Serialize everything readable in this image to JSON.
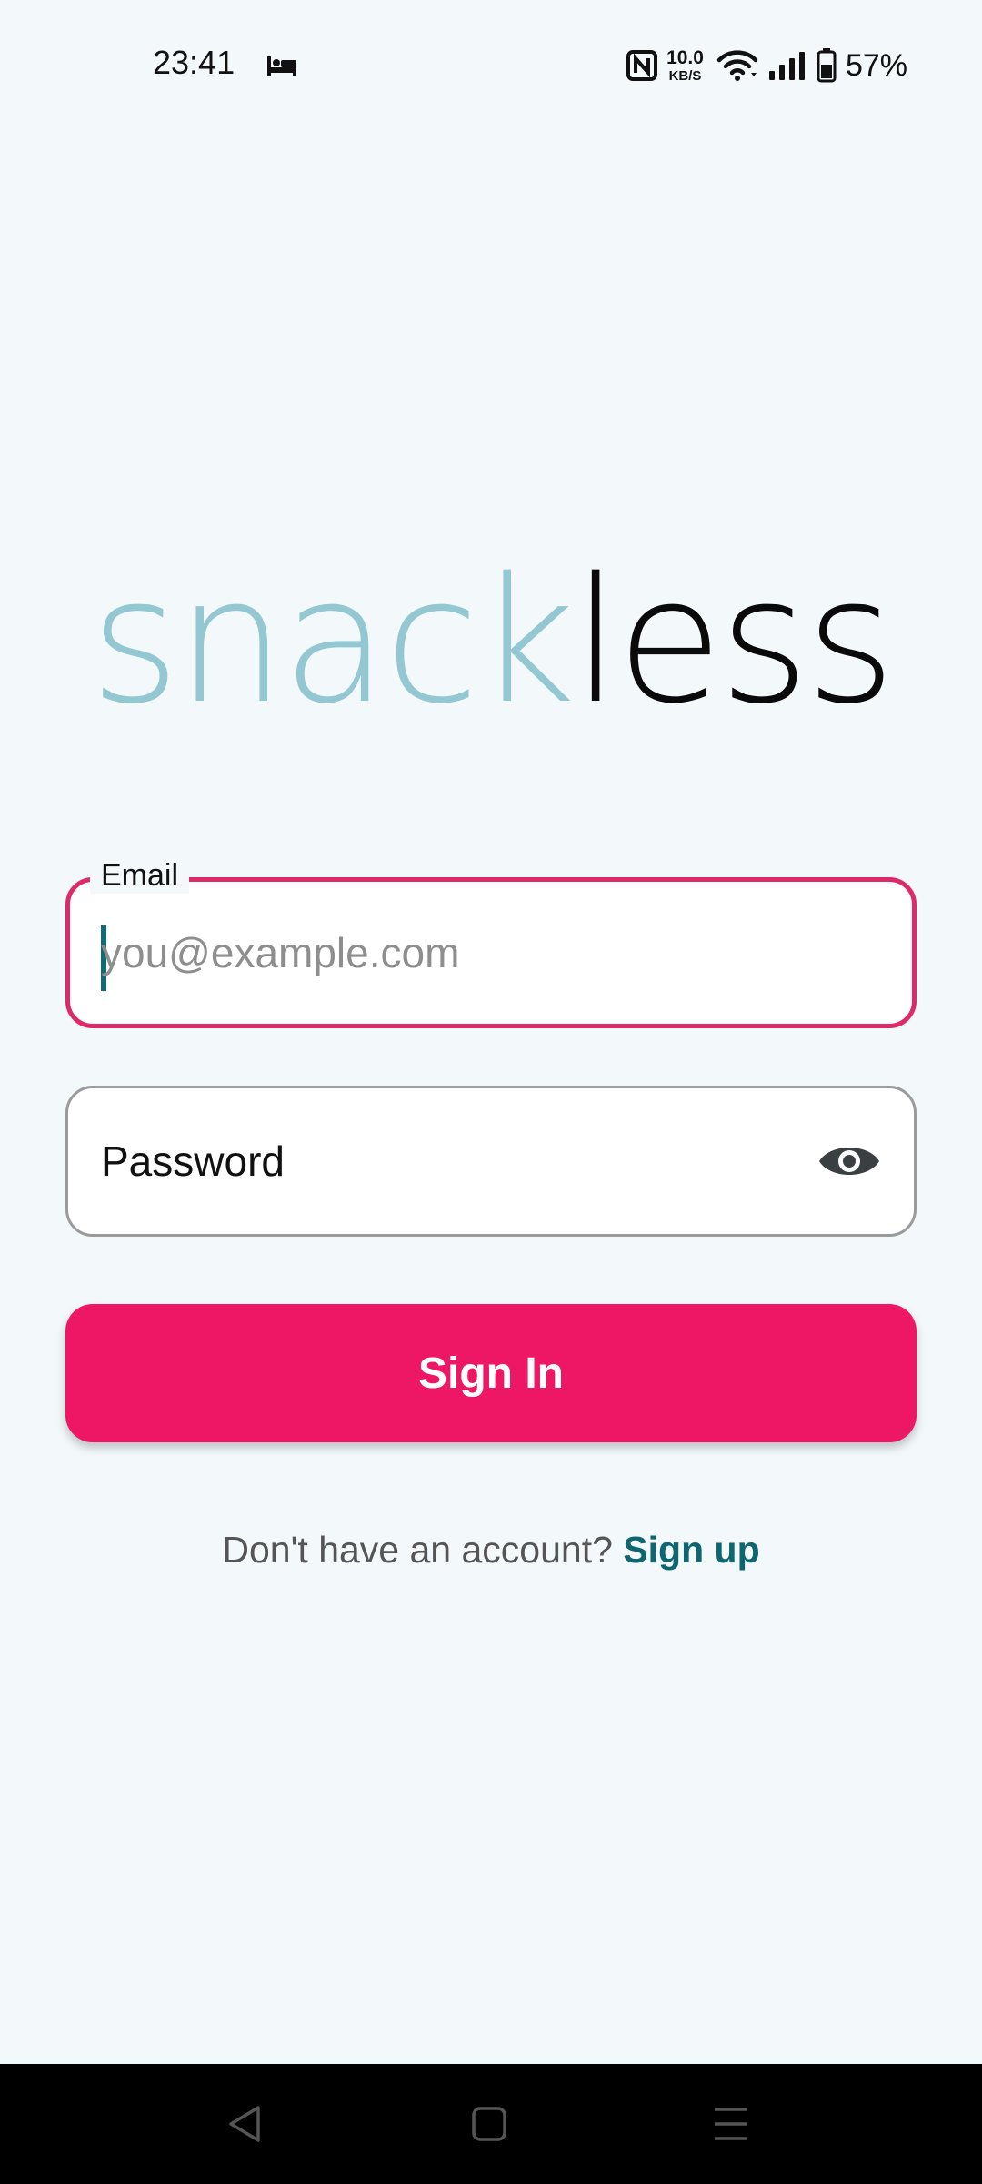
{
  "status_bar": {
    "time": "23:41",
    "net_speed_value": "10.0",
    "net_speed_unit": "KB/S",
    "battery": "57%",
    "icons": [
      "bed-icon",
      "nfc-icon",
      "wifi-icon",
      "signal-icon",
      "battery-icon"
    ]
  },
  "logo": {
    "part1": "snack",
    "part2": "less",
    "colors": {
      "part1": "#93c7d1",
      "part2": "#0a0a0a"
    }
  },
  "email": {
    "label": "Email",
    "placeholder": "you@example.com",
    "value": ""
  },
  "password": {
    "placeholder": "Password",
    "toggle_icon": "eye-icon"
  },
  "signin_button": {
    "label": "Sign In",
    "color": "#ee1765"
  },
  "signup": {
    "prompt": "Don't have an account?",
    "link": "Sign up",
    "link_color": "#0d6670"
  },
  "nav_bar": {
    "buttons": [
      "back-icon",
      "home-icon",
      "recents-icon"
    ]
  }
}
